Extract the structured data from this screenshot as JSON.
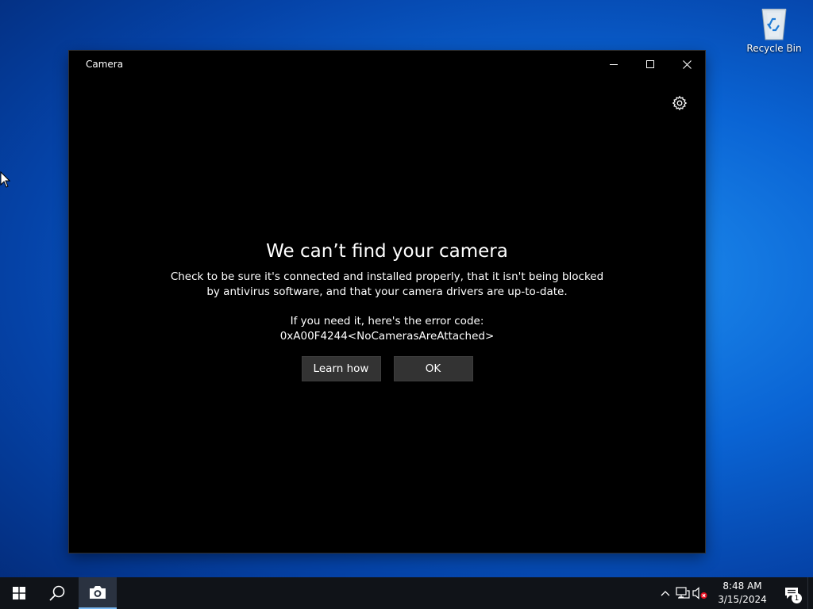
{
  "desktop": {
    "icons": [
      {
        "label": "Recycle Bin",
        "icon": "recycle-bin-icon"
      }
    ]
  },
  "window": {
    "title": "Camera",
    "controls": [
      "minimize-icon",
      "maximize-icon",
      "close-icon"
    ],
    "settings_icon": "gear-icon",
    "error": {
      "heading": "We can’t find your camera",
      "message_line1": "Check to be sure it's connected and installed properly, that it isn't being blocked",
      "message_line2": "by antivirus software, and that your camera drivers are up-to-date.",
      "code_intro": "If you need it, here's the error code:",
      "code": "0xA00F4244<NoCamerasAreAttached>"
    },
    "buttons": {
      "learn_how": "Learn how",
      "ok": "OK"
    }
  },
  "taskbar": {
    "start_icon": "windows-start-icon",
    "search_icon": "search-icon",
    "apps": [
      {
        "name": "Camera",
        "icon": "camera-icon",
        "active": true
      }
    ],
    "tray": {
      "icons": [
        "chevron-up-icon",
        "network-icon",
        "volume-muted-icon"
      ],
      "time": "8:48 AM",
      "date": "3/15/2024",
      "notification_count": "1"
    }
  },
  "colors": {
    "window_bg": "#000000",
    "button_bg": "#333333",
    "taskbar_bg": "#101318",
    "desktop_blue": "#0a64d4"
  }
}
